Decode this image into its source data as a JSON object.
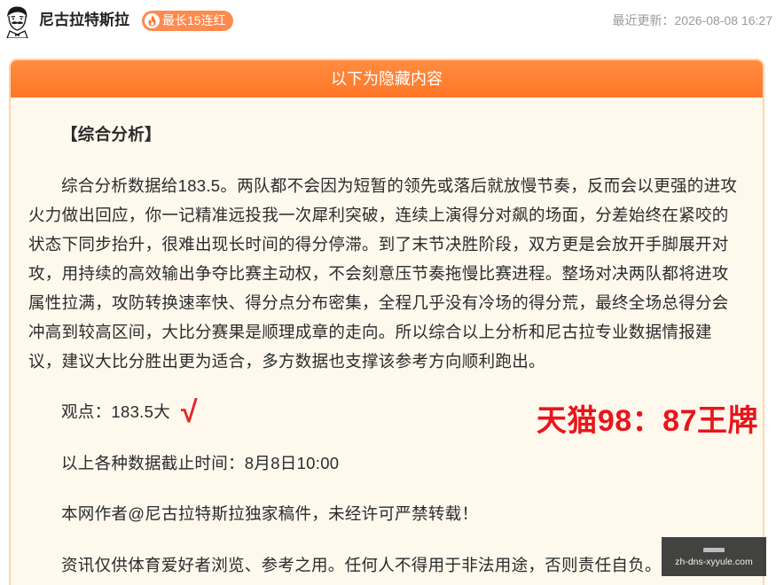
{
  "header": {
    "author_name": "尼古拉特斯拉",
    "badge_label": "最长15连红",
    "badge_icon": "flame-icon",
    "update_text": "最近更新：2026-08-08 16:27",
    "avatar_icon": "avatar-portrait"
  },
  "card": {
    "banner": "以下为隐藏内容",
    "section_title": "【综合分析】",
    "analysis": "综合分析数据给183.5。两队都不会因为短暂的领先或落后就放慢节奏，反而会以更强的进攻火力做出回应，你一记精准远投我一次犀利突破，连续上演得分对飙的场面，分差始终在紧咬的状态下同步抬升，很难出现长时间的得分停滞。到了末节决胜阶段，双方更是会放开手脚展开对攻，用持续的高效输出争夺比赛主动权，不会刻意压节奏拖慢比赛进程。整场对决两队都将进攻属性拉满，攻防转换速率快、得分点分布密集，全程几乎没有冷场的得分荒，最终全场总得分会冲高到较高区间，大比分赛果是顺理成章的走向。所以综合以上分析和尼古拉专业数据情报建议，建议大比分胜出更为适合，多方数据也支撑该参考方向顺利跑出。",
    "viewpoint": "观点：183.5大",
    "check_mark": "√",
    "promo": "天猫98：87王牌",
    "cutoff": "以上各种数据截止时间：8月8日10:00",
    "copyright": "本网作者@尼古拉特斯拉独家稿件，未经许可严禁转载！",
    "disclaimer": "资讯仅供体育爱好者浏览、参考之用。任何人不得用于非法用途，否则责任自负。"
  },
  "watermark": {
    "domain": "zh-dns-xyyule.com"
  },
  "colors": {
    "banner_orange": "#ff7b2e",
    "badge_orange": "#ff8a4e",
    "card_background": "#fff8ed",
    "card_border": "#ffd6ad",
    "promo_red": "#e8161c",
    "check_red": "#e5262a",
    "muted_gray": "#9a9a9a"
  }
}
